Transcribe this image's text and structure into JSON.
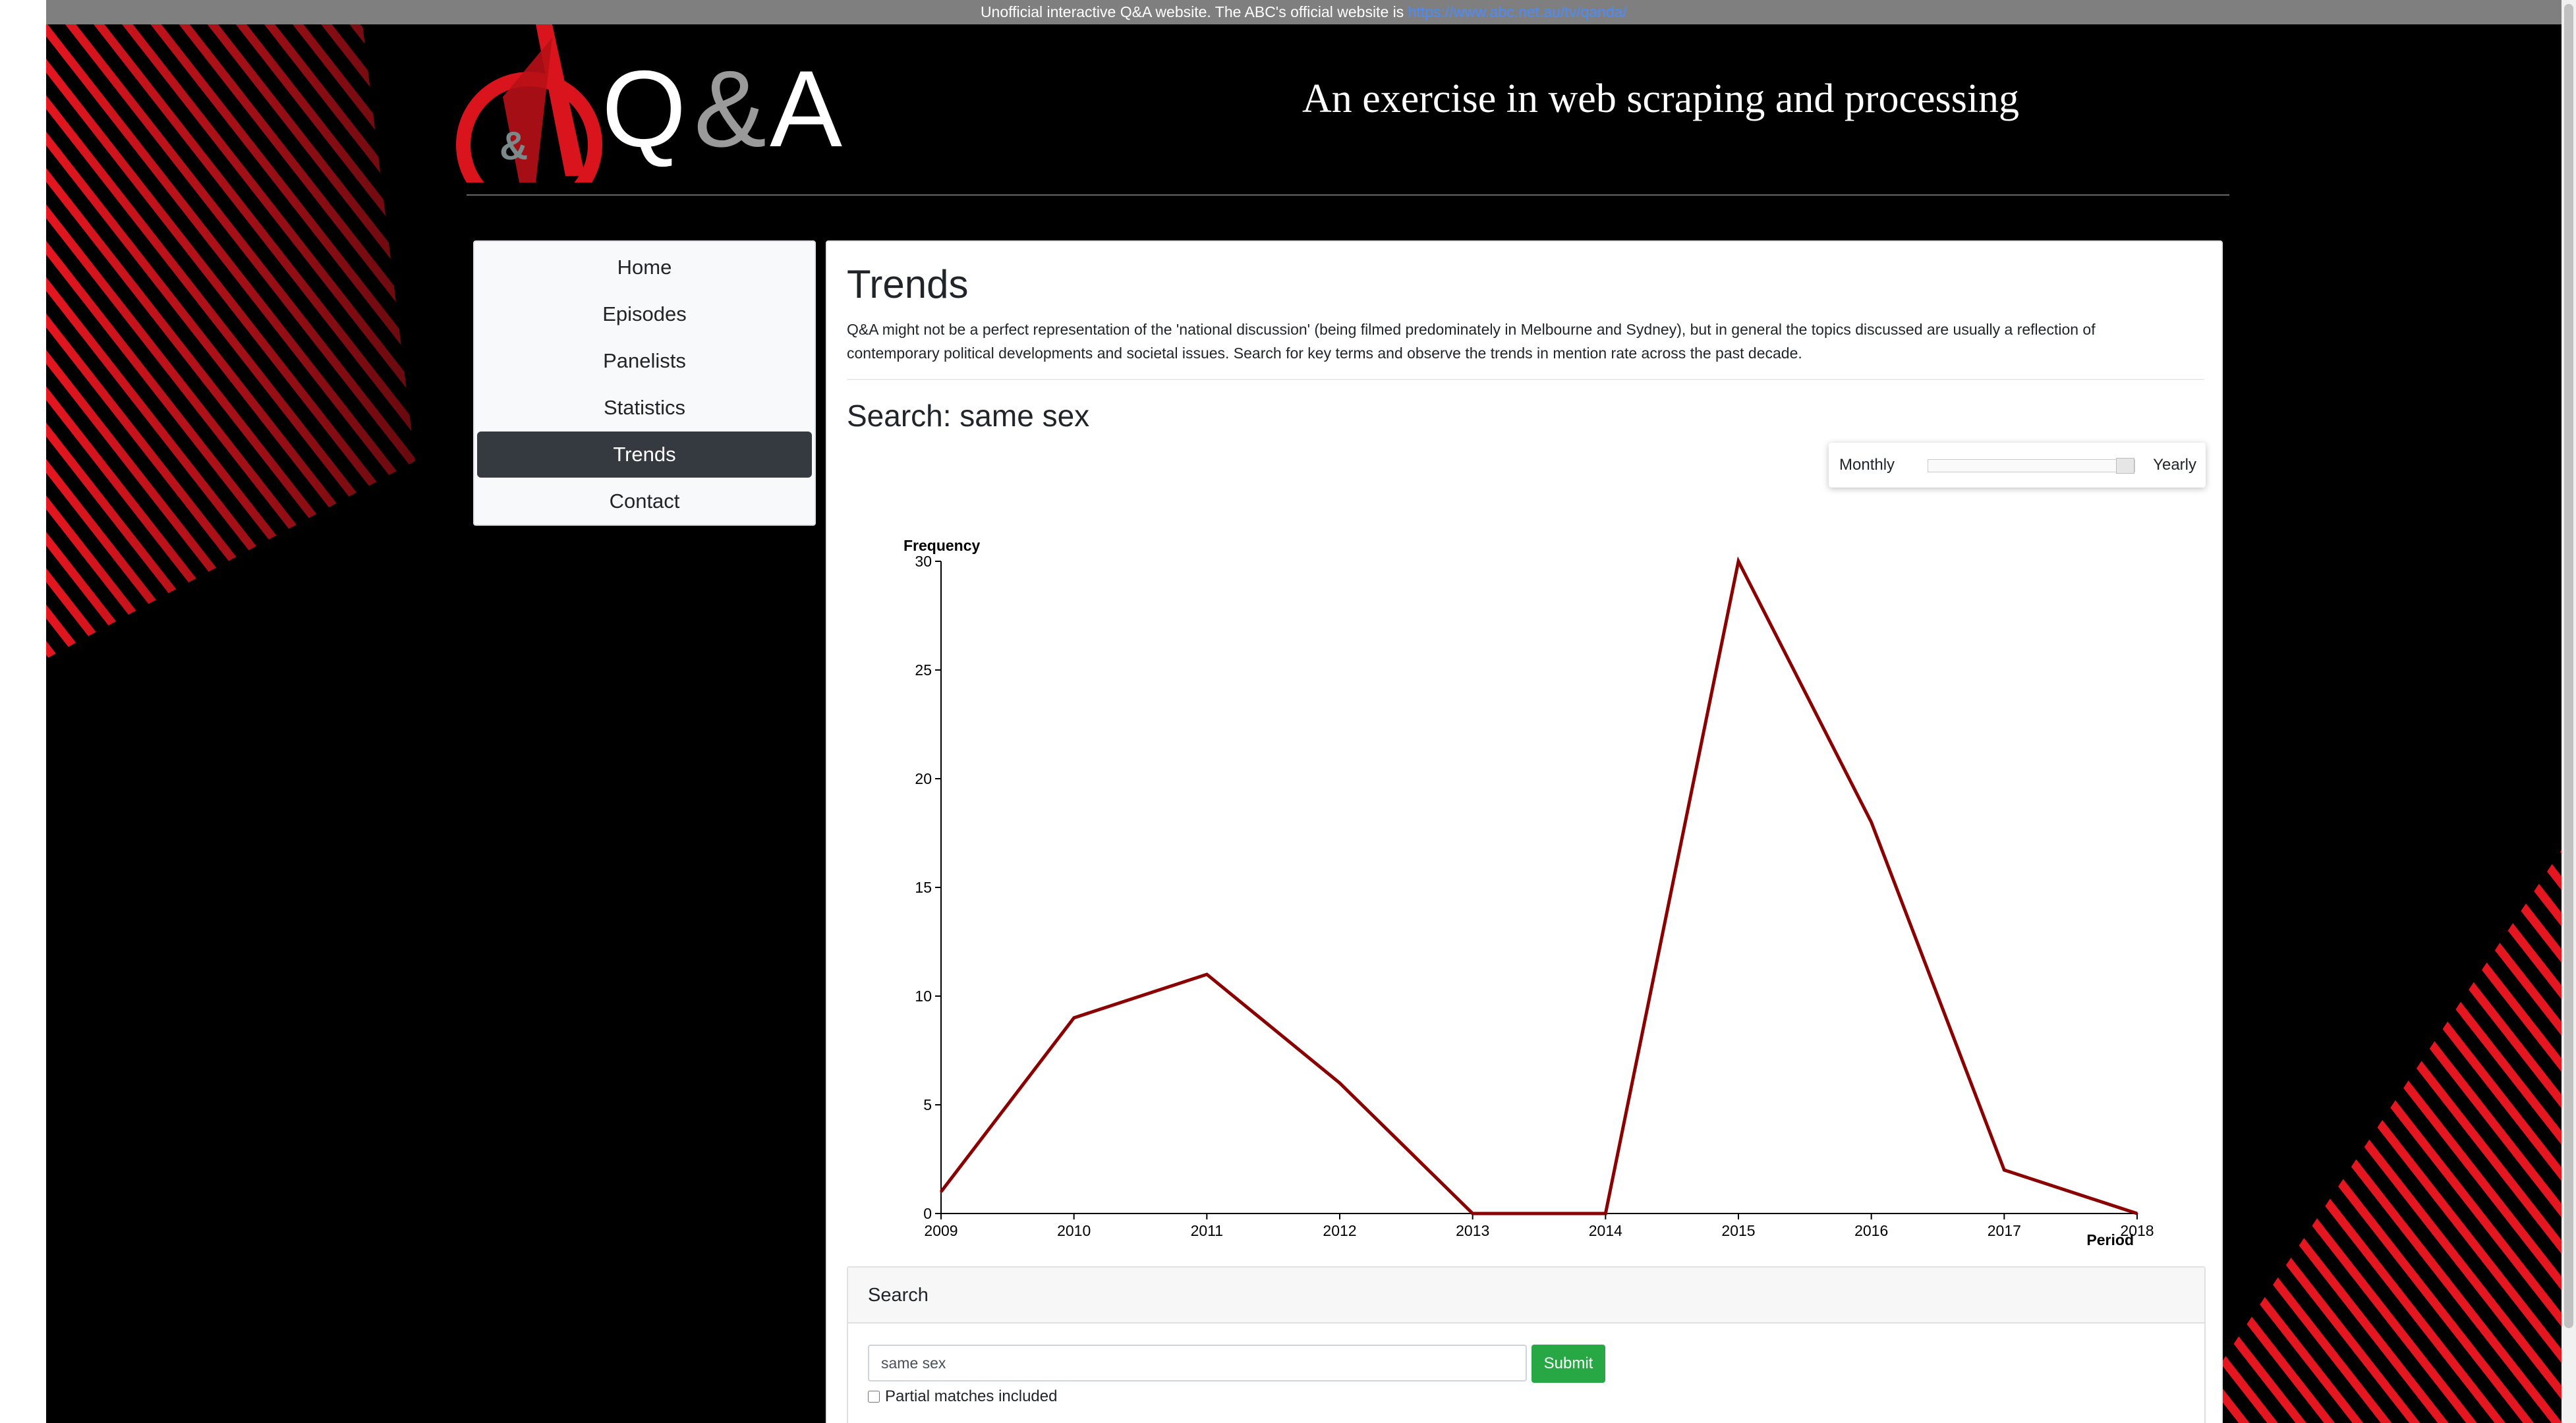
{
  "notice": {
    "text": "Unofficial interactive Q&A website. The ABC's official website is",
    "link": "https://www.abc.net.au/tv/qanda/"
  },
  "logo": {
    "text": "Q&A"
  },
  "header": {
    "tagline": "An exercise in web scraping and processing"
  },
  "sidebar": {
    "items": [
      {
        "label": "Home"
      },
      {
        "label": "Episodes"
      },
      {
        "label": "Panelists"
      },
      {
        "label": "Statistics"
      },
      {
        "label": "Trends"
      },
      {
        "label": "Contact"
      }
    ],
    "active": "Trends"
  },
  "main": {
    "title": "Trends",
    "intro": "Q&A might not be a perfect representation of the 'national discussion' (being filmed predominately in Melbourne and Sydney), but in general the topics discussed are usually a reflection of contemporary political developments and societal issues. Search for key terms and observe the trends in mention rate across the past decade.",
    "search_heading": "Search: same sex"
  },
  "toggle": {
    "monthly": "Monthly",
    "yearly": "Yearly",
    "value": "Yearly"
  },
  "chart_data": {
    "type": "line",
    "x": [
      "2009",
      "2010",
      "2011",
      "2012",
      "2013",
      "2014",
      "2015",
      "2016",
      "2017",
      "2018"
    ],
    "series": [
      {
        "values": [
          1,
          9,
          11,
          6,
          0,
          0,
          30,
          18,
          2,
          0
        ]
      }
    ],
    "ylabel": "Frequency",
    "xlabel": "Period",
    "yticks": [
      0,
      5,
      10,
      15,
      20,
      25,
      30
    ],
    "ylim": [
      0,
      30
    ],
    "grid": false,
    "line_color": "#8b0000"
  },
  "search": {
    "header": "Search",
    "input_value": "same sex",
    "submit_label": "Submit",
    "partial_label": "Partial matches included"
  },
  "colors": {
    "accent": "#e4161f",
    "submit": "#28a745",
    "nav_active": "#343a40"
  }
}
